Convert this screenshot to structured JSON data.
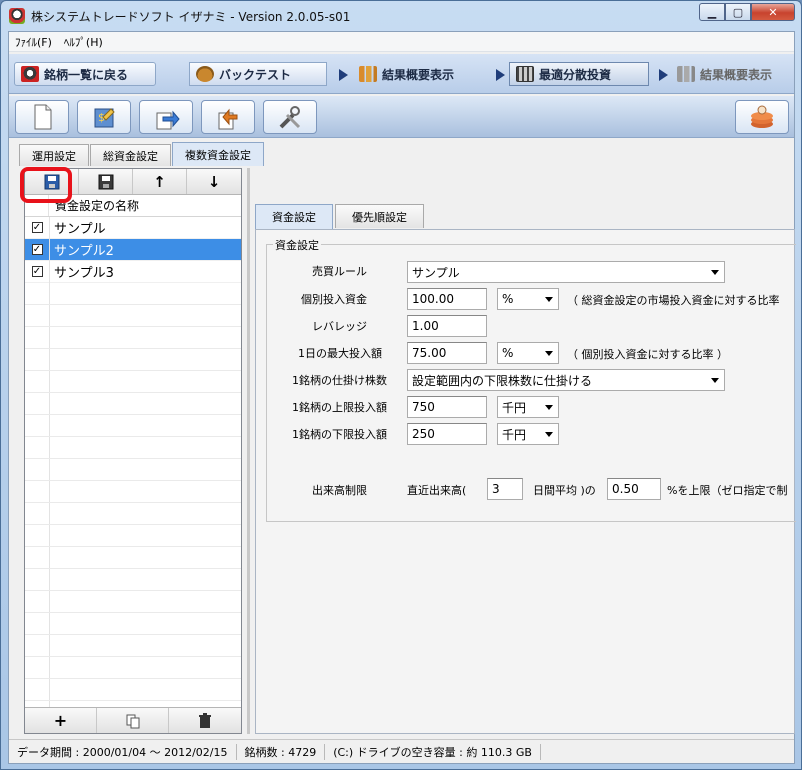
{
  "window": {
    "title": "株システムトレードソフト イザナミ - Version 2.0.05-s01"
  },
  "menu": [
    "ﾌｧｲﾙ(F)",
    "ﾍﾙﾌﾟ(H)"
  ],
  "nav": {
    "back_label": "銘柄一覧に戻る",
    "backtest_label": "バックテスト",
    "result1_label": "結果概要表示",
    "optimize_label": "最適分散投資",
    "result2_label": "結果概要表示"
  },
  "outer_tabs": [
    "運用設定",
    "総資金設定",
    "複数資金設定"
  ],
  "inner_tabs": [
    "資金設定",
    "優先順設定"
  ],
  "settings_list": {
    "header": "資金設定の名称",
    "items": [
      {
        "name": "サンプル",
        "checked": true
      },
      {
        "name": "サンプル2",
        "checked": true
      },
      {
        "name": "サンプル3",
        "checked": true
      }
    ]
  },
  "form": {
    "group_title": "資金設定",
    "trade_rule_label": "売買ルール",
    "trade_rule_value": "サンプル",
    "individual_label": "個別投入資金",
    "individual_value": "100.00",
    "individual_unit": "%",
    "individual_note": "（ 総資金設定の市場投入資金に対する比率",
    "leverage_label": "レバレッジ",
    "leverage_value": "1.00",
    "daily_max_label": "1日の最大投入額",
    "daily_max_value": "75.00",
    "daily_max_unit": "%",
    "daily_max_note": "（ 個別投入資金に対する比率 ）",
    "shares_label": "1銘柄の仕掛け株数",
    "shares_value": "設定範囲内の下限株数に仕掛ける",
    "upper_label": "1銘柄の上限投入額",
    "upper_value": "750",
    "upper_unit": "千円",
    "lower_label": "1銘柄の下限投入額",
    "lower_value": "250",
    "lower_unit": "千円",
    "volume_label": "出来高制限",
    "volume_text1": "直近出来高(",
    "volume_days": "3",
    "volume_text2": "日間平均 )の",
    "volume_ratio": "0.50",
    "volume_text3": "%を上限（ゼロ指定で制"
  },
  "status": {
    "period": "データ期間 : 2000/01/04 〜 2012/02/15",
    "count": "銘柄数 : 4729",
    "disk": "(C:) ドライブの空き容量 : 約 110.3 GB"
  }
}
